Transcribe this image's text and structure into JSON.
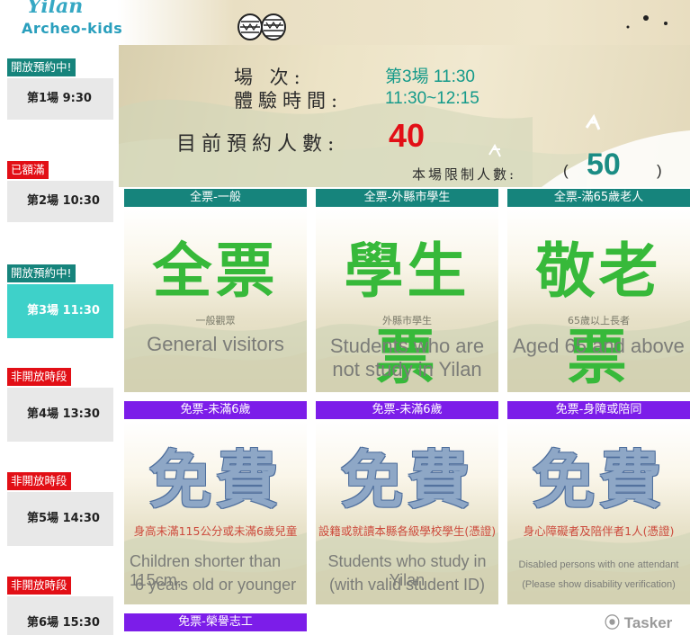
{
  "header": {
    "logo_top": "Yilan",
    "logo_bottom": "Archeo-kids"
  },
  "sidebar": {
    "slots": [
      {
        "status": "開放預約中!",
        "label": "第1場  9:30",
        "state": "open",
        "selected": false
      },
      {
        "status": "已額滿",
        "label": "第2場 10:30",
        "state": "full",
        "selected": false
      },
      {
        "status": "開放預約中!",
        "label": "第3場 11:30",
        "state": "open",
        "selected": true
      },
      {
        "status": "非開放時段",
        "label": "第4場 13:30",
        "state": "closed",
        "selected": false
      },
      {
        "status": "非開放時段",
        "label": "第5場 14:30",
        "state": "closed",
        "selected": false
      },
      {
        "status": "非開放時段",
        "label": "第6場 15:30",
        "state": "closed",
        "selected": false
      }
    ]
  },
  "info": {
    "session_label": "場  次:",
    "session_value": "第3場 11:30",
    "time_label": "體驗時間:",
    "time_value": "11:30~12:15",
    "booked_label": "目前預約人數:",
    "booked_value": "40",
    "limit_label": "本場限制人數:",
    "limit_open": "(",
    "limit_value": "50",
    "limit_close": ")"
  },
  "tickets": [
    {
      "header": "全票-一般",
      "big": "全票",
      "cn": "一般觀眾",
      "en1": "General visitors",
      "en2": ""
    },
    {
      "header": "全票-外縣市學生",
      "big": "學生票",
      "cn": "外縣市學生",
      "en1": "Students who are",
      "en2": "not  study in Yilan"
    },
    {
      "header": "全票-滿65歲老人",
      "big": "敬老票",
      "cn": "65歲以上長者",
      "en1": "Aged 65 and above",
      "en2": ""
    },
    {
      "header": "免票-未滿6歲",
      "big": "免費",
      "cn": "身高未滿115公分或未滿6歲兒童",
      "en1": "Children shorter than 115cm,",
      "en2": "6 years old or younger"
    },
    {
      "header": "免票-未滿6歲",
      "big": "免費",
      "cn": "設籍或就讀本縣各級學校學生(憑證)",
      "en1": "Students who  study in Yilan",
      "en2": "(with valid student ID)"
    },
    {
      "header": "免票-身障或陪同",
      "big": "免費",
      "cn": "身心障礙者及陪伴者1人(憑證)",
      "en1": "Disabled persons with one attendant",
      "en2": "(Please show disability verification)"
    },
    {
      "header": "免票-榮譽志工"
    }
  ],
  "watermark": "Tasker",
  "colors": {
    "teal": "#16847c",
    "purple": "#7c1de9",
    "red": "#e20f16",
    "selected": "#3ed1c9",
    "booked": "#e20f16",
    "green_text": "#37b93a"
  }
}
